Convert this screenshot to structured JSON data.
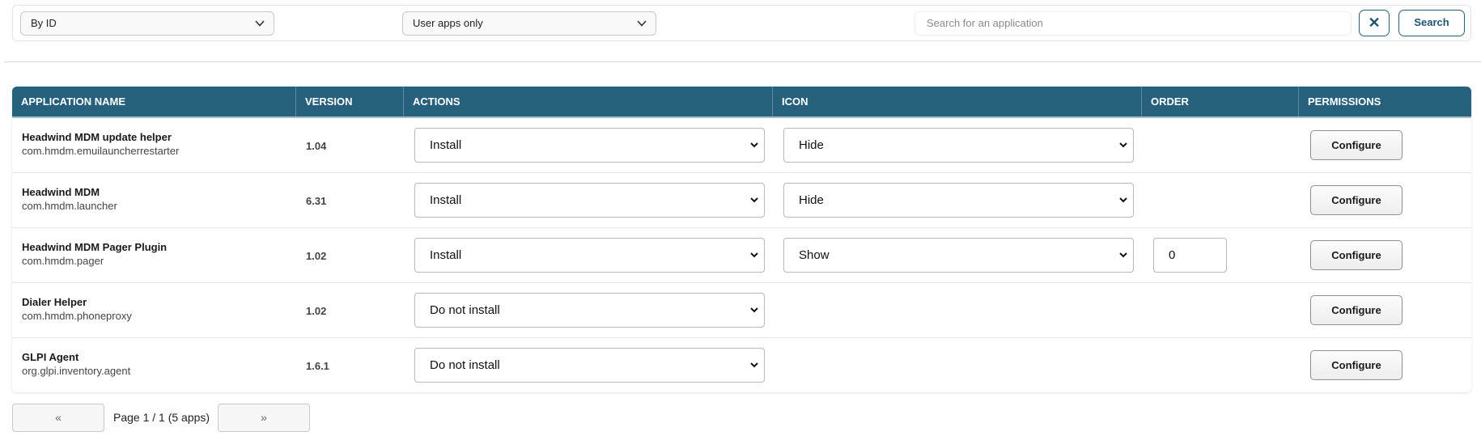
{
  "filters": {
    "sort": {
      "selected": "By ID"
    },
    "type": {
      "selected": "User apps only"
    },
    "search": {
      "placeholder": "Search for an application"
    },
    "clear_label": "✕",
    "search_label": "Search"
  },
  "table": {
    "headers": [
      "APPLICATION NAME",
      "VERSION",
      "ACTIONS",
      "ICON",
      "ORDER",
      "PERMISSIONS"
    ],
    "configure_label": "Configure",
    "rows": [
      {
        "name": "Headwind MDM update helper",
        "package": "com.hmdm.emuilauncherrestarter",
        "version": "1.04",
        "action": "Install",
        "icon": "Hide",
        "order": ""
      },
      {
        "name": "Headwind MDM",
        "package": "com.hmdm.launcher",
        "version": "6.31",
        "action": "Install",
        "icon": "Hide",
        "order": ""
      },
      {
        "name": "Headwind MDM Pager Plugin",
        "package": "com.hmdm.pager",
        "version": "1.02",
        "action": "Install",
        "icon": "Show",
        "order": "0"
      },
      {
        "name": "Dialer Helper",
        "package": "com.hmdm.phoneproxy",
        "version": "1.02",
        "action": "Do not install",
        "icon": "",
        "order": ""
      },
      {
        "name": "GLPI Agent",
        "package": "org.glpi.inventory.agent",
        "version": "1.6.1",
        "action": "Do not install",
        "icon": "",
        "order": ""
      }
    ]
  },
  "pager": {
    "prev_label": "«",
    "next_label": "»",
    "info": "Page 1 / 1 (5 apps)"
  },
  "colors": {
    "header_bg": "#26607d",
    "accent": "#1f5471"
  }
}
